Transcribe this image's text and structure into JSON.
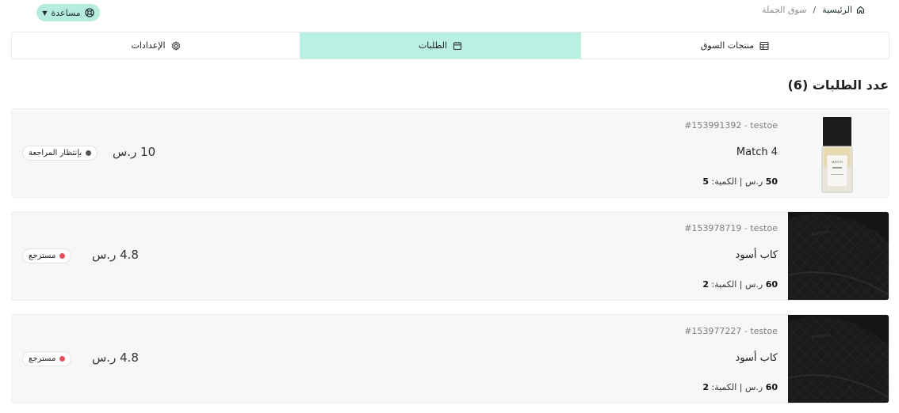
{
  "header": {
    "help_label": "مساعدة",
    "breadcrumb": {
      "home": "الرئيسية",
      "separator": "/",
      "current": "سوق الجملة"
    }
  },
  "tabs": [
    {
      "label": "منتجات السوق",
      "icon": "table-icon",
      "active": false
    },
    {
      "label": "الطلبات",
      "icon": "calendar-icon",
      "active": true
    },
    {
      "label": "الإعدادات",
      "icon": "gear-icon",
      "active": false
    }
  ],
  "orders_count_title": "عدد الطلبات (6)",
  "orders": [
    {
      "id": "#153991392 - testoe",
      "name": "Match 4",
      "price_line_bold": "50",
      "price_line_rest": " ر.س | الكمية:",
      "quantity": "5",
      "total": "10 ر.س",
      "status": "بإنتظار المراجعة",
      "status_color": "#555555",
      "thumbnail": "perfume-bottle"
    },
    {
      "id": "#153978719 - testoe",
      "name": "كاب أسود",
      "price_line_bold": "60",
      "price_line_rest": " ر.س | الكمية:",
      "quantity": "2",
      "total": "4.8 ر.س",
      "status": "مسترجع",
      "status_color": "#e0535a",
      "thumbnail": "black-cap"
    },
    {
      "id": "#153977227 - testoe",
      "name": "كاب أسود",
      "price_line_bold": "60",
      "price_line_rest": " ر.س | الكمية:",
      "quantity": "2",
      "total": "4.8 ر.س",
      "status": "مسترجع",
      "status_color": "#e0535a",
      "thumbnail": "black-cap"
    }
  ],
  "colors": {
    "accent": "#b5ecdd",
    "active_tab": "#b9f0e1"
  }
}
